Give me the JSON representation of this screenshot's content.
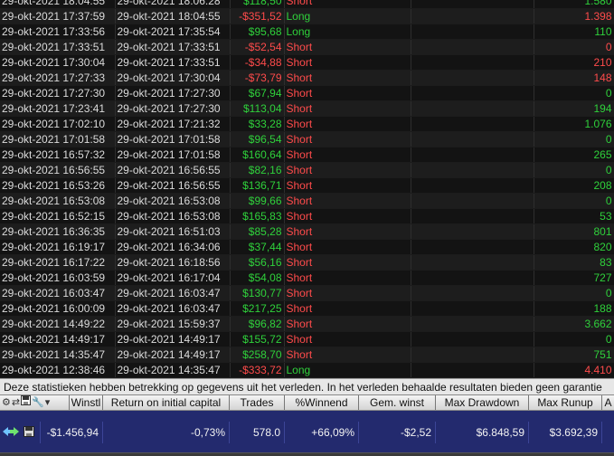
{
  "trades": [
    {
      "entry": "29-okt-2021 18:04:55",
      "exit": "29-okt-2021 18:06:28",
      "profit": "$118,50",
      "side": "Short",
      "qty": "1.580",
      "profit_sign": "pos",
      "qty_sign": "pos"
    },
    {
      "entry": "29-okt-2021 17:37:59",
      "exit": "29-okt-2021 18:04:55",
      "profit": "-$351,52",
      "side": "Long",
      "qty": "1.398",
      "profit_sign": "neg",
      "qty_sign": "neg"
    },
    {
      "entry": "29-okt-2021 17:33:56",
      "exit": "29-okt-2021 17:35:54",
      "profit": "$95,68",
      "side": "Long",
      "qty": "110",
      "profit_sign": "pos",
      "qty_sign": "pos"
    },
    {
      "entry": "29-okt-2021 17:33:51",
      "exit": "29-okt-2021 17:33:51",
      "profit": "-$52,54",
      "side": "Short",
      "qty": "0",
      "profit_sign": "neg",
      "qty_sign": "neg"
    },
    {
      "entry": "29-okt-2021 17:30:04",
      "exit": "29-okt-2021 17:33:51",
      "profit": "-$34,88",
      "side": "Short",
      "qty": "210",
      "profit_sign": "neg",
      "qty_sign": "neg"
    },
    {
      "entry": "29-okt-2021 17:27:33",
      "exit": "29-okt-2021 17:30:04",
      "profit": "-$73,79",
      "side": "Short",
      "qty": "148",
      "profit_sign": "neg",
      "qty_sign": "neg"
    },
    {
      "entry": "29-okt-2021 17:27:30",
      "exit": "29-okt-2021 17:27:30",
      "profit": "$67,94",
      "side": "Short",
      "qty": "0",
      "profit_sign": "pos",
      "qty_sign": "pos"
    },
    {
      "entry": "29-okt-2021 17:23:41",
      "exit": "29-okt-2021 17:27:30",
      "profit": "$113,04",
      "side": "Short",
      "qty": "194",
      "profit_sign": "pos",
      "qty_sign": "pos"
    },
    {
      "entry": "29-okt-2021 17:02:10",
      "exit": "29-okt-2021 17:21:32",
      "profit": "$33,28",
      "side": "Short",
      "qty": "1.076",
      "profit_sign": "pos",
      "qty_sign": "pos"
    },
    {
      "entry": "29-okt-2021 17:01:58",
      "exit": "29-okt-2021 17:01:58",
      "profit": "$96,54",
      "side": "Short",
      "qty": "0",
      "profit_sign": "pos",
      "qty_sign": "pos"
    },
    {
      "entry": "29-okt-2021 16:57:32",
      "exit": "29-okt-2021 17:01:58",
      "profit": "$160,64",
      "side": "Short",
      "qty": "265",
      "profit_sign": "pos",
      "qty_sign": "pos"
    },
    {
      "entry": "29-okt-2021 16:56:55",
      "exit": "29-okt-2021 16:56:55",
      "profit": "$82,16",
      "side": "Short",
      "qty": "0",
      "profit_sign": "pos",
      "qty_sign": "pos"
    },
    {
      "entry": "29-okt-2021 16:53:26",
      "exit": "29-okt-2021 16:56:55",
      "profit": "$136,71",
      "side": "Short",
      "qty": "208",
      "profit_sign": "pos",
      "qty_sign": "pos"
    },
    {
      "entry": "29-okt-2021 16:53:08",
      "exit": "29-okt-2021 16:53:08",
      "profit": "$99,66",
      "side": "Short",
      "qty": "0",
      "profit_sign": "pos",
      "qty_sign": "pos"
    },
    {
      "entry": "29-okt-2021 16:52:15",
      "exit": "29-okt-2021 16:53:08",
      "profit": "$165,83",
      "side": "Short",
      "qty": "53",
      "profit_sign": "pos",
      "qty_sign": "pos"
    },
    {
      "entry": "29-okt-2021 16:36:35",
      "exit": "29-okt-2021 16:51:03",
      "profit": "$85,28",
      "side": "Short",
      "qty": "801",
      "profit_sign": "pos",
      "qty_sign": "pos"
    },
    {
      "entry": "29-okt-2021 16:19:17",
      "exit": "29-okt-2021 16:34:06",
      "profit": "$37,44",
      "side": "Short",
      "qty": "820",
      "profit_sign": "pos",
      "qty_sign": "pos"
    },
    {
      "entry": "29-okt-2021 16:17:22",
      "exit": "29-okt-2021 16:18:56",
      "profit": "$56,16",
      "side": "Short",
      "qty": "83",
      "profit_sign": "pos",
      "qty_sign": "pos"
    },
    {
      "entry": "29-okt-2021 16:03:59",
      "exit": "29-okt-2021 16:17:04",
      "profit": "$54,08",
      "side": "Short",
      "qty": "727",
      "profit_sign": "pos",
      "qty_sign": "pos"
    },
    {
      "entry": "29-okt-2021 16:03:47",
      "exit": "29-okt-2021 16:03:47",
      "profit": "$130,77",
      "side": "Short",
      "qty": "0",
      "profit_sign": "pos",
      "qty_sign": "pos"
    },
    {
      "entry": "29-okt-2021 16:00:09",
      "exit": "29-okt-2021 16:03:47",
      "profit": "$217,25",
      "side": "Short",
      "qty": "188",
      "profit_sign": "pos",
      "qty_sign": "pos"
    },
    {
      "entry": "29-okt-2021 14:49:22",
      "exit": "29-okt-2021 15:59:37",
      "profit": "$96,82",
      "side": "Short",
      "qty": "3.662",
      "profit_sign": "pos",
      "qty_sign": "pos"
    },
    {
      "entry": "29-okt-2021 14:49:17",
      "exit": "29-okt-2021 14:49:17",
      "profit": "$155,72",
      "side": "Short",
      "qty": "0",
      "profit_sign": "pos",
      "qty_sign": "pos"
    },
    {
      "entry": "29-okt-2021 14:35:47",
      "exit": "29-okt-2021 14:49:17",
      "profit": "$258,70",
      "side": "Short",
      "qty": "751",
      "profit_sign": "pos",
      "qty_sign": "pos"
    },
    {
      "entry": "29-okt-2021 12:38:46",
      "exit": "29-okt-2021 14:35:47",
      "profit": "-$333,72",
      "side": "Long",
      "qty": "4.410",
      "profit_sign": "neg",
      "qty_sign": "neg"
    }
  ],
  "notice": "Deze statistieken hebben betrekking op gegevens uit het verleden. In het verleden behaalde resultaten bieden geen garantie",
  "stats_headers": [
    "Winstl",
    "Return on initial capital",
    "Trades",
    "%Winnend",
    "Gem. winst",
    "Max Drawdown",
    "Max Runup",
    "A"
  ],
  "stats_values": [
    "-$1.456,94",
    "-0,73%",
    "578.0",
    "+66,09%",
    "-$2,52",
    "$6.848,59",
    "$3.692,39",
    ""
  ],
  "colors": {
    "positive": "#2fd13b",
    "negative": "#ff4b4b",
    "summary_bg": "#232a6e"
  },
  "icons": {
    "settings": "gear-icon",
    "save": "save-icon",
    "tools": "wrench-icon",
    "menu": "dropdown-icon",
    "navigate": "arrows-icon"
  }
}
